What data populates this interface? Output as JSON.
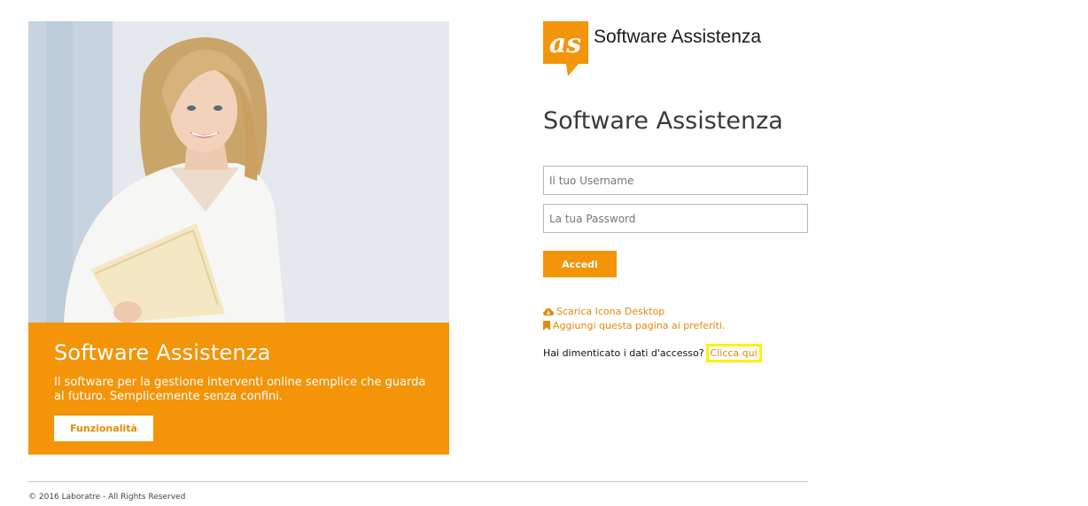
{
  "hero": {
    "title": "Software Assistenza",
    "description": "Il software per la gestione interventi online semplice che guarda al futuro. Semplicemente senza confini.",
    "features_button": "Funzionalità"
  },
  "brand": {
    "logo_mark": "as",
    "logo_text": "Software Assistenza",
    "accent_color": "#f39409"
  },
  "login": {
    "title": "Software Assistenza",
    "username_placeholder": "Il tuo Username",
    "password_placeholder": "La tua Password",
    "submit_label": "Accedi"
  },
  "links": {
    "download_icon": "cloud-download-icon",
    "download_label": "Scarica Icona Desktop",
    "bookmark_icon": "bookmark-icon",
    "bookmark_label": "Aggiungi questa pagina ai preferiti.",
    "forgot_text": "Hai dimenticato i dati d'accesso?",
    "forgot_link": "Clicca qui"
  },
  "footer": {
    "copyright": "© 2016 Laboratre - All Rights Reserved"
  }
}
